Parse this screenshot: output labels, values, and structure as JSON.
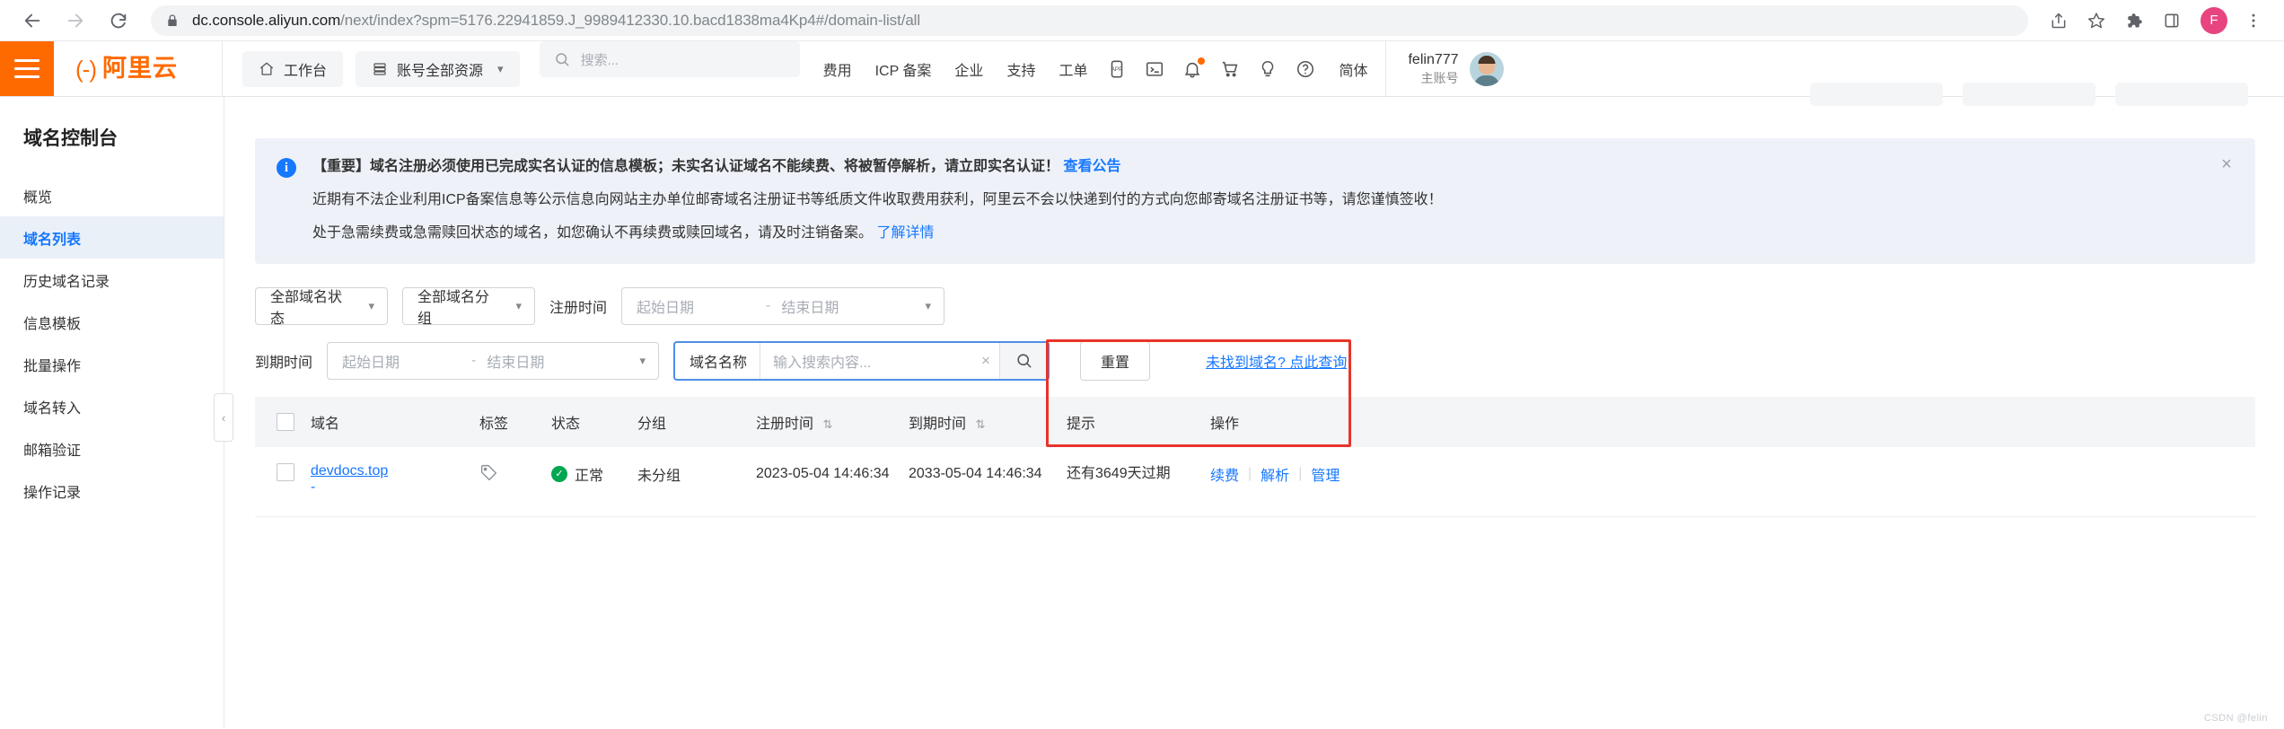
{
  "browser": {
    "url_domain": "dc.console.aliyun.com",
    "url_path": "/next/index?spm=5176.22941859.J_9989412330.10.bacd1838ma4Kp4#/domain-list/all",
    "back_label": "back-arrow",
    "forward_label": "forward-arrow",
    "reload_label": "reload",
    "profile_initial": "F"
  },
  "header": {
    "logo_bracket": "(-)",
    "logo_text": "阿里云",
    "workbench": "工作台",
    "resource_selector": "账号全部资源",
    "search_placeholder": "搜索...",
    "nav": [
      {
        "label": "费用"
      },
      {
        "label": "ICP 备案"
      },
      {
        "label": "企业"
      },
      {
        "label": "支持"
      },
      {
        "label": "工单"
      }
    ],
    "lang": "简体",
    "user_name": "felin777",
    "user_role": "主账号"
  },
  "sidebar": {
    "title": "域名控制台",
    "items": [
      {
        "label": "概览",
        "active": false
      },
      {
        "label": "域名列表",
        "active": true
      },
      {
        "label": "历史域名记录",
        "active": false
      },
      {
        "label": "信息模板",
        "active": false
      },
      {
        "label": "批量操作",
        "active": false
      },
      {
        "label": "域名转入",
        "active": false
      },
      {
        "label": "邮箱验证",
        "active": false
      },
      {
        "label": "操作记录",
        "active": false
      }
    ]
  },
  "banner": {
    "line1_text": "【重要】域名注册必须使用已完成实名认证的信息模板；未实名认证域名不能续费、将被暂停解析，请立即实名认证！",
    "line1_link": "查看公告",
    "line2": "近期有不法企业利用ICP备案信息等公示信息向网站主办单位邮寄域名注册证书等纸质文件收取费用获利，阿里云不会以快递到付的方式向您邮寄域名注册证书等，请您谨慎签收！",
    "line3_text": "处于急需续费或急需赎回状态的域名，如您确认不再续费或赎回域名，请及时注销备案。",
    "line3_link": "了解详情",
    "close_label": "×"
  },
  "filters": {
    "status_select": "全部域名状态",
    "group_select": "全部域名分组",
    "reg_time_label": "注册时间",
    "exp_time_label": "到期时间",
    "start_date_placeholder": "起始日期",
    "end_date_placeholder": "结束日期",
    "date_separator": "-",
    "search_label": "域名名称",
    "search_placeholder": "输入搜索内容...",
    "clear_label": "×",
    "reset_label": "重置",
    "not_found_link": "未找到域名? 点此查询"
  },
  "table": {
    "columns": [
      {
        "key": "domain",
        "label": "域名"
      },
      {
        "key": "tag",
        "label": "标签"
      },
      {
        "key": "status",
        "label": "状态"
      },
      {
        "key": "group",
        "label": "分组"
      },
      {
        "key": "reg_time",
        "label": "注册时间",
        "sortable": true
      },
      {
        "key": "exp_time",
        "label": "到期时间",
        "sortable": true
      },
      {
        "key": "tip",
        "label": "提示"
      },
      {
        "key": "op",
        "label": "操作"
      }
    ],
    "sort_glyph": "⇅",
    "rows": [
      {
        "domain": "devdocs.top",
        "domain_sub": "-",
        "status": "正常",
        "status_glyph": "✓",
        "group": "未分组",
        "reg_time": "2023-05-04 14:46:34",
        "exp_time": "2033-05-04 14:46:34",
        "tip": "还有3649天过期",
        "actions": [
          "续费",
          "解析",
          "管理"
        ]
      }
    ]
  },
  "colors": {
    "brand_orange": "#ff6a00",
    "link_blue": "#1677ff",
    "highlight_red": "#e8342a",
    "status_green": "#00a650"
  },
  "watermark": "CSDN @felin"
}
